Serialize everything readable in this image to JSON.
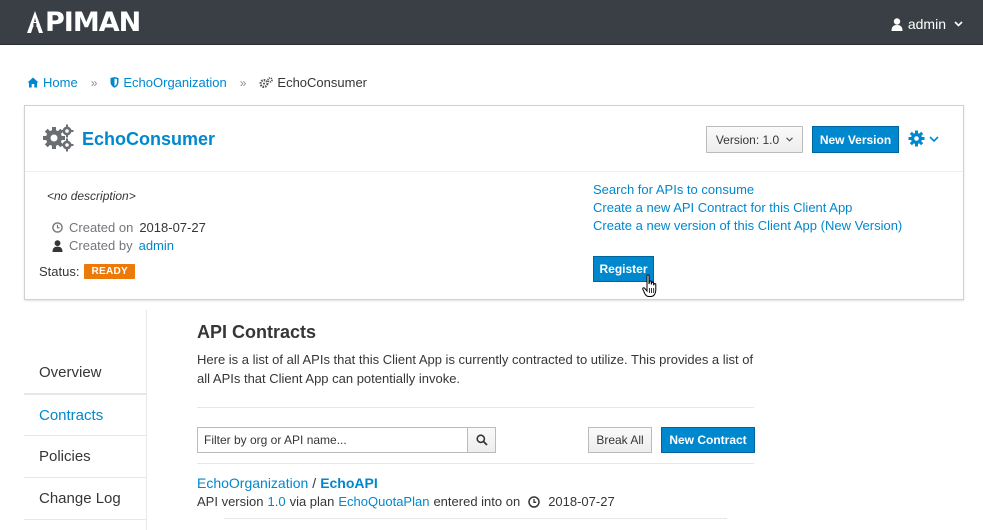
{
  "app": {
    "logo_text": "PIMAN",
    "logo_letter": "A"
  },
  "user_menu": {
    "username": "admin"
  },
  "breadcrumb": {
    "home": "Home",
    "organization": "EchoOrganization",
    "current": "EchoConsumer"
  },
  "header": {
    "title": "EchoConsumer",
    "version_label": "Version: 1.0",
    "new_version_label": "New Version"
  },
  "details": {
    "description": "<no description>",
    "created_on_label": "Created on",
    "created_on_value": "2018-07-27",
    "created_by_label": "Created by",
    "created_by_value": "admin",
    "status_label": "Status:",
    "status_value": "READY"
  },
  "actions": {
    "search_link": "Search for APIs to consume",
    "new_contract_link": "Create a new API Contract for this Client App",
    "new_version_link": "Create a new version of this Client App (New Version)",
    "register_label": "Register"
  },
  "sidenav": {
    "items": [
      {
        "label": "Overview"
      },
      {
        "label": "Contracts"
      },
      {
        "label": "Policies"
      },
      {
        "label": "Change Log"
      }
    ]
  },
  "contracts": {
    "title": "API Contracts",
    "description": "Here is a list of all APIs that this Client App is currently contracted to utilize. This provides a list of all APIs that Client App can potentially invoke.",
    "filter_placeholder": "Filter by org or API name...",
    "break_all_label": "Break All",
    "new_contract_label": "New Contract",
    "rows": [
      {
        "org": "EchoOrganization",
        "separator": "/",
        "api": "EchoAPI",
        "api_version_label": "API version",
        "api_version": "1.0",
        "via_plan_label": "via plan",
        "plan": "EchoQuotaPlan",
        "entered_label": "entered into on",
        "date": "2018-07-27"
      }
    ]
  },
  "colors": {
    "navbar": "#393f44",
    "primary": "#0088ce",
    "status_ready": "#ec7a08"
  }
}
